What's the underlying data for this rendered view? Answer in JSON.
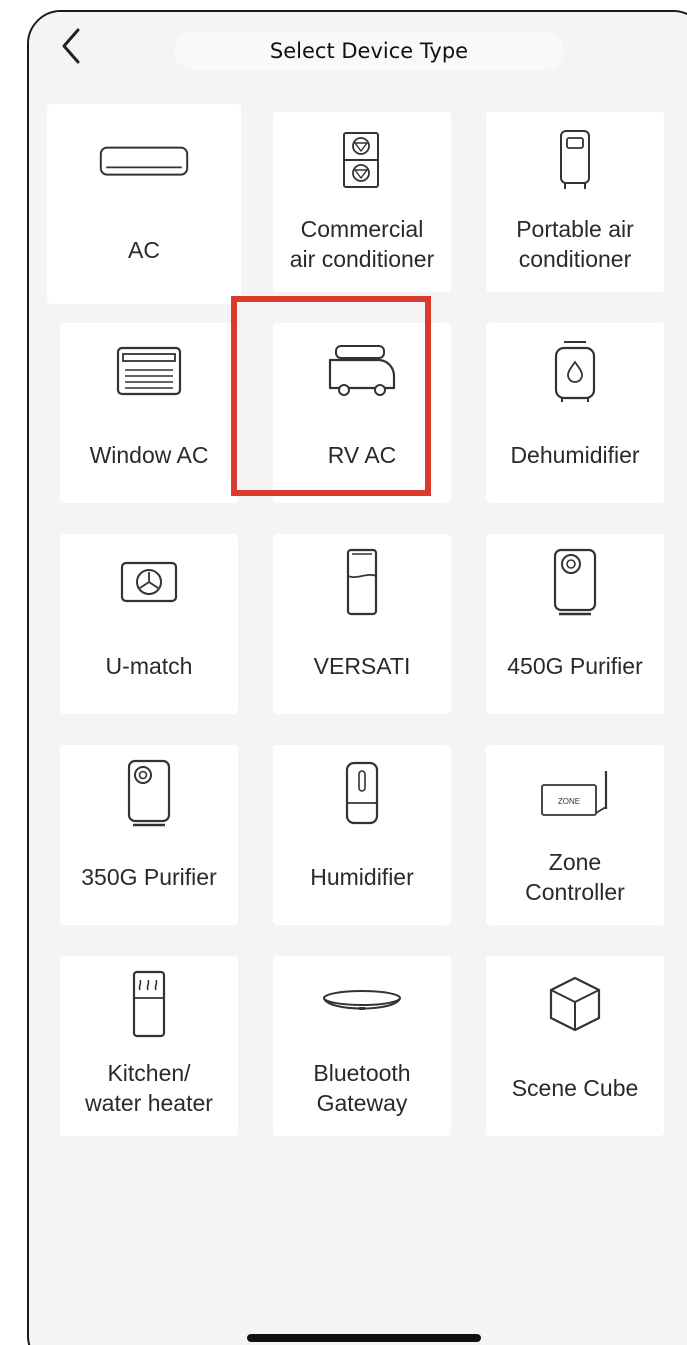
{
  "header": {
    "title": "Select Device Type",
    "back_icon": "chevron-left-icon"
  },
  "devices": [
    {
      "label": "AC",
      "icon": "wall-ac-icon"
    },
    {
      "label": "Commercial\nair conditioner",
      "icon": "commercial-ac-icon"
    },
    {
      "label": "Portable air\nconditioner",
      "icon": "portable-ac-icon"
    },
    {
      "label": "Window AC",
      "icon": "window-ac-icon"
    },
    {
      "label": "RV AC",
      "icon": "rv-ac-icon"
    },
    {
      "label": "Dehumidifier",
      "icon": "dehumidifier-icon"
    },
    {
      "label": "U-match",
      "icon": "u-match-icon"
    },
    {
      "label": "VERSATI",
      "icon": "versati-icon"
    },
    {
      "label": "450G Purifier",
      "icon": "purifier-450g-icon"
    },
    {
      "label": "350G Purifier",
      "icon": "purifier-350g-icon"
    },
    {
      "label": "Humidifier",
      "icon": "humidifier-icon"
    },
    {
      "label": "Zone\nController",
      "icon": "zone-controller-icon"
    },
    {
      "label": "Kitchen/\nwater heater",
      "icon": "water-heater-icon"
    },
    {
      "label": "Bluetooth\nGateway",
      "icon": "bluetooth-gateway-icon"
    },
    {
      "label": "Scene Cube",
      "icon": "scene-cube-icon"
    }
  ],
  "zone_icon_text": "ZONE",
  "highlighted_device": "RV AC",
  "colors": {
    "highlight": "#d93a2b",
    "background": "#f4f4f6",
    "card": "#ffffff",
    "text": "#2a2a2a"
  }
}
